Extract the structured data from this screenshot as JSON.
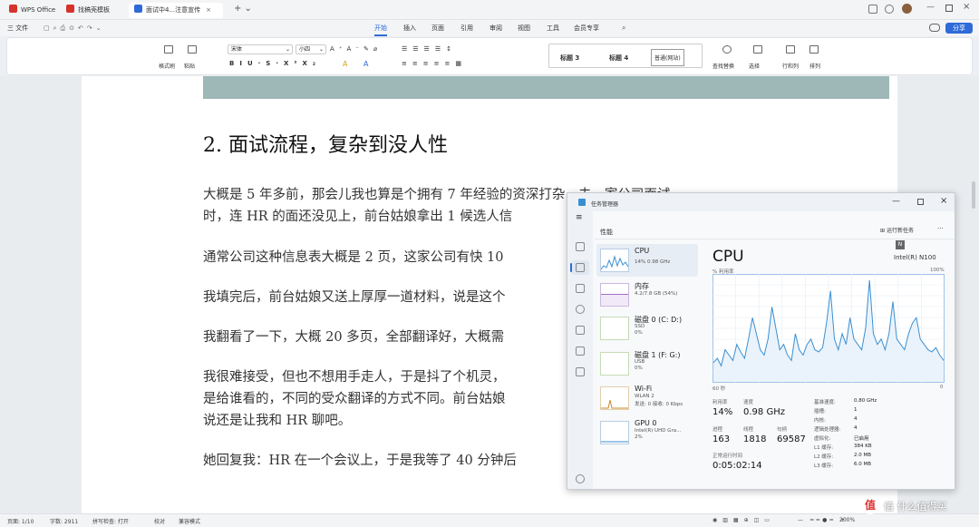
{
  "tabs": [
    {
      "label": "WPS Office",
      "color": "#d6332a"
    },
    {
      "label": "找稿壳模板",
      "color": "#d6332a"
    },
    {
      "label": "面试中4...注意宣传",
      "color": "#2f6bd8"
    }
  ],
  "quick_access": {
    "file_label": "三 文件"
  },
  "menu": [
    "开始",
    "插入",
    "页面",
    "引用",
    "审阅",
    "视图",
    "工具",
    "会员专享"
  ],
  "share_label": "分享",
  "ribbon": {
    "format_painter": "格式刷",
    "paste": "粘贴",
    "font_name": "宋体",
    "font_size": "小四",
    "styles": [
      "标题 3",
      "标题 4",
      "普通(网站)"
    ],
    "find_replace": "查找替换",
    "select": "选择",
    "row_col": "行和列",
    "arrange": "排列"
  },
  "document": {
    "heading": "2. 面试流程，复杂到没人性",
    "paragraphs": [
      [
        "大概是 5 年多前，那会儿我也算是个拥有 7 年经验的资深打杂，去一家公司面试",
        "时，连 HR 的面还没见上，前台姑娘拿出 1 候选人信"
      ],
      [
        "通常公司这种信息表大概是 2 页，这家公司有快 10"
      ],
      [
        "我填完后，前台姑娘又送上厚厚一道材料，说是这个"
      ],
      [
        "我翻看了一下，大概 20 多页，全部翻译好，大概需"
      ],
      [
        "我很难接受，但也不想用手走人，于是抖了个机灵，",
        "是给谁看的，不同的受众翻译的方式不同。前台姑娘",
        "说还是让我和 HR 聊吧。"
      ],
      [
        "她回复我：HR 在一个会议上，于是我等了 40 分钟后"
      ]
    ]
  },
  "status": {
    "page": "页面: 1/10",
    "words": "字数: 2911",
    "spell": "拼写检查: 打开",
    "proofread": "校对",
    "compat": "兼容模式",
    "zoom": "200%"
  },
  "task_manager": {
    "title": "任务管理器",
    "section": "性能",
    "run_task": "运行新任务",
    "more": "···",
    "items": [
      {
        "name": "CPU",
        "sub": [
          "14% 0.98 GHz"
        ]
      },
      {
        "name": "内存",
        "sub": [
          "4.2/7.8 GB (54%)"
        ]
      },
      {
        "name": "磁盘 0 (C: D:)",
        "sub": [
          "SSD",
          "0%"
        ]
      },
      {
        "name": "磁盘 1 (F: G:)",
        "sub": [
          "USB",
          "0%"
        ]
      },
      {
        "name": "Wi-Fi",
        "sub": [
          "WLAN 2",
          "发送: 0 接收: 0 Kbps"
        ]
      },
      {
        "name": "GPU 0",
        "sub": [
          "Intel(R) UHD Gra...",
          "2%"
        ]
      }
    ],
    "cpu_title": "CPU",
    "cpu_model": "Intel(R) N100",
    "graph_label": "% 利用率",
    "graph_max": "100%",
    "graph_time": "60 秒",
    "graph_min": "0",
    "stats": {
      "util_label": "利用率",
      "util": "14%",
      "speed_label": "速度",
      "speed": "0.98 GHz",
      "proc_label": "进程",
      "proc": "163",
      "thread_label": "线程",
      "thread": "1818",
      "handle_label": "句柄",
      "handle": "69587",
      "uptime_label": "正常运行时间",
      "uptime": "0:05:02:14"
    },
    "specs": [
      [
        "基准速度:",
        "0.80 GHz"
      ],
      [
        "插槽:",
        "1"
      ],
      [
        "内核:",
        "4"
      ],
      [
        "逻辑处理器:",
        "4"
      ],
      [
        "虚拟化:",
        "已启用"
      ],
      [
        "L1 缓存:",
        "384 KB"
      ],
      [
        "L2 缓存:",
        "2.0 MB"
      ],
      [
        "L3 缓存:",
        "6.0 MB"
      ]
    ]
  },
  "chart_data": {
    "type": "area",
    "ylim": [
      0,
      100
    ],
    "values": [
      18,
      22,
      15,
      30,
      25,
      20,
      35,
      28,
      22,
      40,
      60,
      45,
      30,
      25,
      40,
      70,
      50,
      30,
      35,
      25,
      20,
      45,
      30,
      25,
      35,
      40,
      30,
      28,
      32,
      55,
      85,
      40,
      30,
      45,
      35,
      60,
      40,
      35,
      30,
      50,
      95,
      45,
      35,
      40,
      30,
      45,
      75,
      40,
      35,
      30,
      45,
      55,
      60,
      40,
      35,
      30,
      28,
      32,
      25,
      20
    ]
  },
  "watermark": "值 什么值得买"
}
